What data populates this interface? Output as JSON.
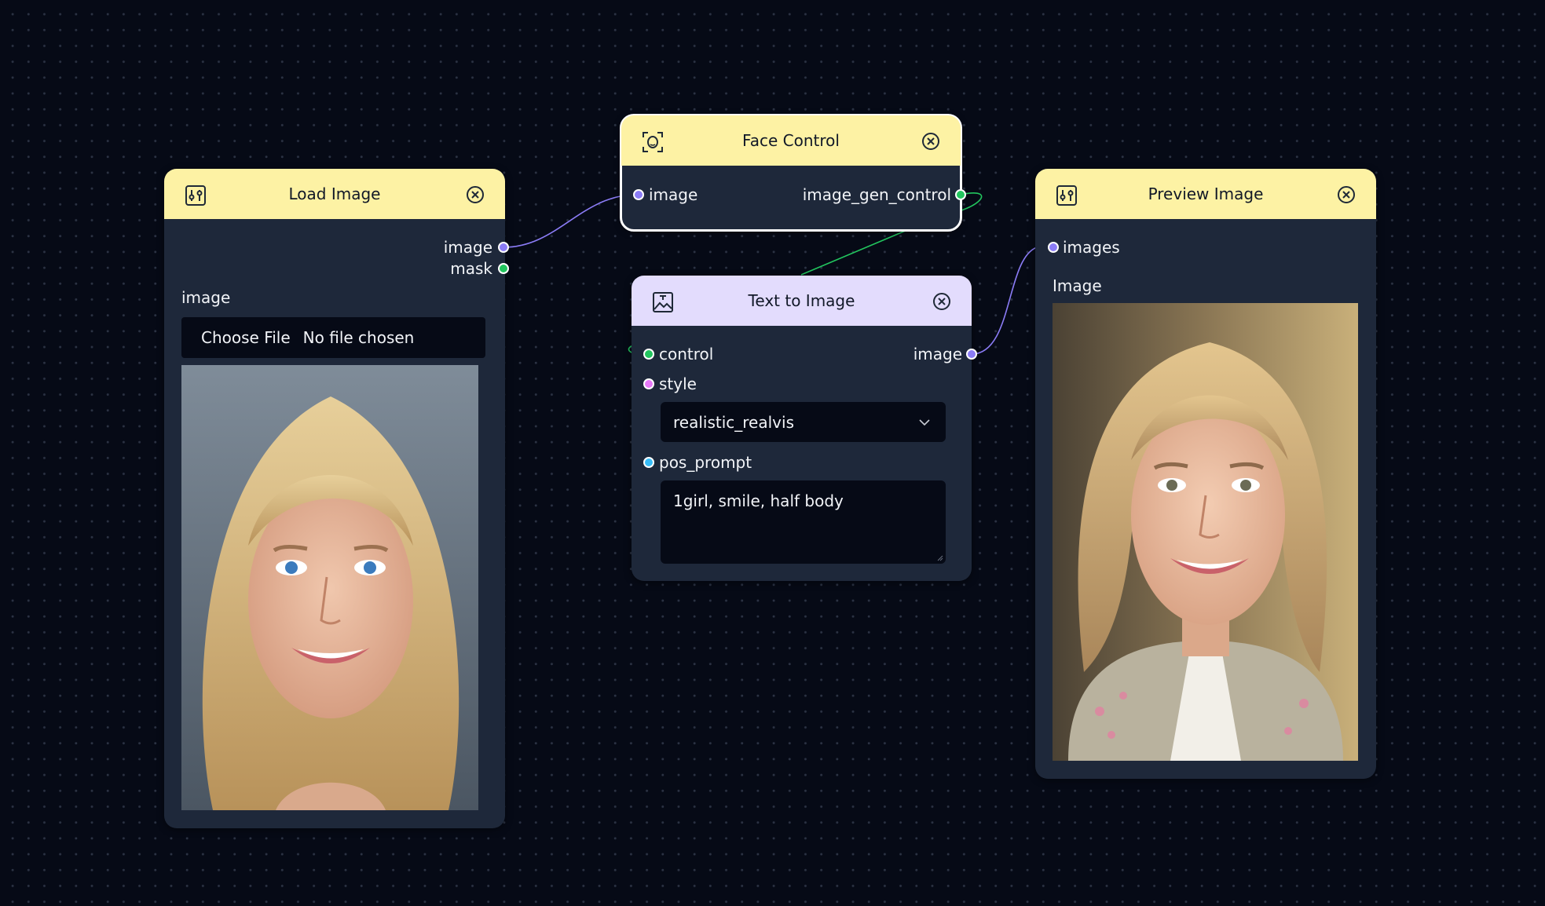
{
  "colors": {
    "canvas": "#060a16",
    "node_body": "#1e283a",
    "header_yellow": "#fdf2a4",
    "header_purple": "#e3dcfd",
    "port_image": "#8b7cf6",
    "port_mask": "#22c55e",
    "port_control": "#22c55e",
    "port_style": "#e879f9",
    "port_prompt": "#38bdf8"
  },
  "nodes": {
    "load_image": {
      "title": "Load Image",
      "icon": "sliders-icon",
      "outputs": {
        "image": "image",
        "mask": "mask"
      },
      "field_label": "image",
      "file_button": "Choose File",
      "file_status": "No file chosen"
    },
    "face_control": {
      "title": "Face Control",
      "icon": "face-scan-icon",
      "inputs": {
        "image": "image"
      },
      "outputs": {
        "control": "image_gen_control"
      }
    },
    "text_to_image": {
      "title": "Text to Image",
      "icon": "image-text-icon",
      "inputs": {
        "control": "control",
        "style": "style",
        "prompt": "pos_prompt"
      },
      "outputs": {
        "image": "image"
      },
      "style_value": "realistic_realvis",
      "prompt_value": "1girl, smile, half body"
    },
    "preview_image": {
      "title": "Preview Image",
      "icon": "sliders-icon",
      "inputs": {
        "images": "images"
      },
      "field_label": "Image"
    }
  }
}
